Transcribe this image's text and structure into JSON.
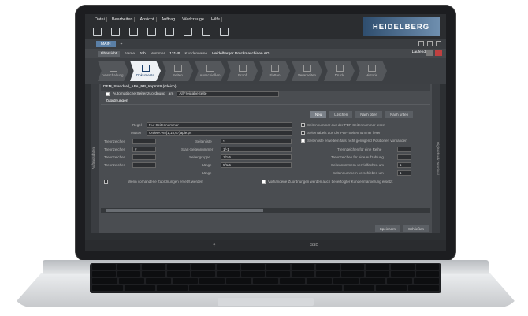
{
  "menu": [
    "Datei",
    "Bearbeiten",
    "Ansicht",
    "Auftrag",
    "Werkzeuge",
    "Hilfe"
  ],
  "brand": {
    "logo_text": "HEIDELBERG",
    "logo_color": "#2e4d6e"
  },
  "tab": {
    "label": "MAIN",
    "plus": "+"
  },
  "crumb": {
    "overview": "Übersicht",
    "name_label": "Name",
    "name_value": "Job",
    "number_label": "Nummer",
    "number_value": "13149",
    "customer_label": "Kundenname",
    "customer_value": "Heidelberger Druckmaschinen AG",
    "status": "Laufend"
  },
  "steps": [
    {
      "label": "Vorschaltung"
    },
    {
      "label": "Dokumente"
    },
    {
      "label": "Seiten"
    },
    {
      "label": "Ausschießen"
    },
    {
      "label": "Proof"
    },
    {
      "label": "Platten"
    },
    {
      "label": "Verarbeiten"
    },
    {
      "label": "Druck"
    },
    {
      "label": "Historie"
    }
  ],
  "side": {
    "left": "Auftragsdaten",
    "right": "Digitaldruck Terminal"
  },
  "panel": {
    "title": "DEM_Standard_APA_RB_Imprmt# (Gleich)",
    "auto_label": "Automatische Seitenzuordnung",
    "am_label": "am",
    "am_value": "AllFreigabeSeite",
    "section": "Zuordnungen",
    "buttons": [
      "Neu",
      "Löschen",
      "Nach oben",
      "Nach unten"
    ],
    "regel_label": "Regel",
    "regel_value": "Nur Seitennummer",
    "muster_label": "Muster",
    "muster_value": "Order#.%5{1,15,67}apie.ps",
    "cb1": "Seitennummer aus der PDF-Seitennummer lesen",
    "cb2": "Seitenlabels aus der PDF-Seitennummer lesen",
    "cb3": "Seitenliste erweitern falls nicht genügend Positionen vorhanden",
    "left_fields": [
      {
        "label": "Trennzeichen",
        "value": "_"
      },
      {
        "label": "Trennzeichen",
        "value": "#"
      },
      {
        "label": "Trennzeichen",
        "value": ""
      },
      {
        "label": "Trennzeichen",
        "value": ""
      }
    ],
    "mid_fields": [
      {
        "label": "Seitenliste",
        "value": "*"
      },
      {
        "label": "Start-Seitennummer",
        "value": "1/-1"
      },
      {
        "label": "Seitengruppe",
        "value": "1/1/5"
      },
      {
        "label": "Länge",
        "value": "5/1/5"
      },
      {
        "label": "Länge",
        "value": "Lieferungsgr."
      }
    ],
    "right_fields": [
      {
        "label": "Trennzeichen für eine Reihe",
        "value": ""
      },
      {
        "label": "Trennzeichen für eine Aufzählung",
        "value": ""
      },
      {
        "label": "Seitennummern vervielfachen um",
        "value": "1"
      },
      {
        "label": "Seitennummern verschieben um",
        "value": "1"
      }
    ],
    "bottom_left": "Wenn vorhandene Zuordnungen ersetzt werden",
    "bottom_right": "Vorhandene Zuordnungen werden auch bei erfolgter Kundenmarkierung ersetzt",
    "save": "Speichern",
    "close": "Schließen"
  },
  "search_placeholder": "Suchen...",
  "status": {
    "left": "⚲",
    "right": "SSD"
  }
}
